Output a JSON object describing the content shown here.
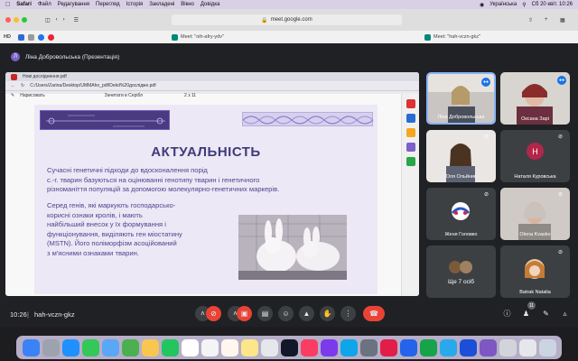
{
  "menubar": {
    "items": [
      "Safari",
      "Файл",
      "Редагування",
      "Перегляд",
      "Історія",
      "Закладені",
      "Вікно",
      "Довідка"
    ],
    "keyboard": "Українська",
    "date_time": "Сб 20 квіт. 10:26"
  },
  "browser": {
    "url": "meet.google.com",
    "bookmark_hd": "HD",
    "tab1_title": "Meet: \"oih-afry-ydv\"",
    "tab2_title": "Meet: \"hah-vczn-gkz\""
  },
  "meeting": {
    "presenter_initial": "Л",
    "presenter_label": "Ліна Добровольська (Презентація)",
    "time": "10:26",
    "code": "hah-vczn-gkz",
    "participant_count": "11"
  },
  "pdf": {
    "tab_title": "Нові досліднення.pdf",
    "file_path": "C:/Users/Zarina/Desktop/UMMAho_pdf/Dekd%20дослідже.pdf",
    "toolbar_left": "Нарисовать",
    "toolbar_mid": "Зачитати в Серібл",
    "page": "2 з 11"
  },
  "slide": {
    "title": "АКТУАЛЬНІСТЬ",
    "para1": [
      "Сучасні генетичні підходи до вдосконалення порід",
      "с.-г. тварин базуються на оцінюванні генотипу тварин і генетичного",
      "різноманіття популяцій за допомогою молекулярно-генетичних маркерів."
    ],
    "para2": [
      "Серед генів, які маркують господарсько-",
      "корисні ознаки кролів, і мають",
      "найбільший внесок у їх формування і",
      "функціонування, виділяють ген міостатину",
      "(MSTN). Його поліморфізм асоційований",
      "з м'ясними ознаками тварин."
    ]
  },
  "participants": [
    {
      "name": "Ліна Добровольська",
      "kind": "video",
      "speaking": true
    },
    {
      "name": "Оксана Зарі",
      "kind": "video",
      "speaking": true
    },
    {
      "name": "Оля Ольйник",
      "kind": "video",
      "muted": true
    },
    {
      "name": "Наталя Куровська",
      "kind": "initial",
      "initial": "Н",
      "color": "#b3264a",
      "muted": true
    },
    {
      "name": "Женя Головко",
      "kind": "avatar",
      "muted": true
    },
    {
      "name": "Olena Kvasko",
      "kind": "video",
      "muted": true
    },
    {
      "name": "Ще 7 осіб",
      "kind": "more"
    },
    {
      "name": "Batrak Natalia",
      "kind": "avatar",
      "muted": true
    }
  ],
  "colors": {
    "meet_bg": "#202124",
    "tile_bg": "#3c4043",
    "end_call": "#ea4335",
    "accent": "#1a73e8",
    "slide_title": "#403a7a"
  }
}
